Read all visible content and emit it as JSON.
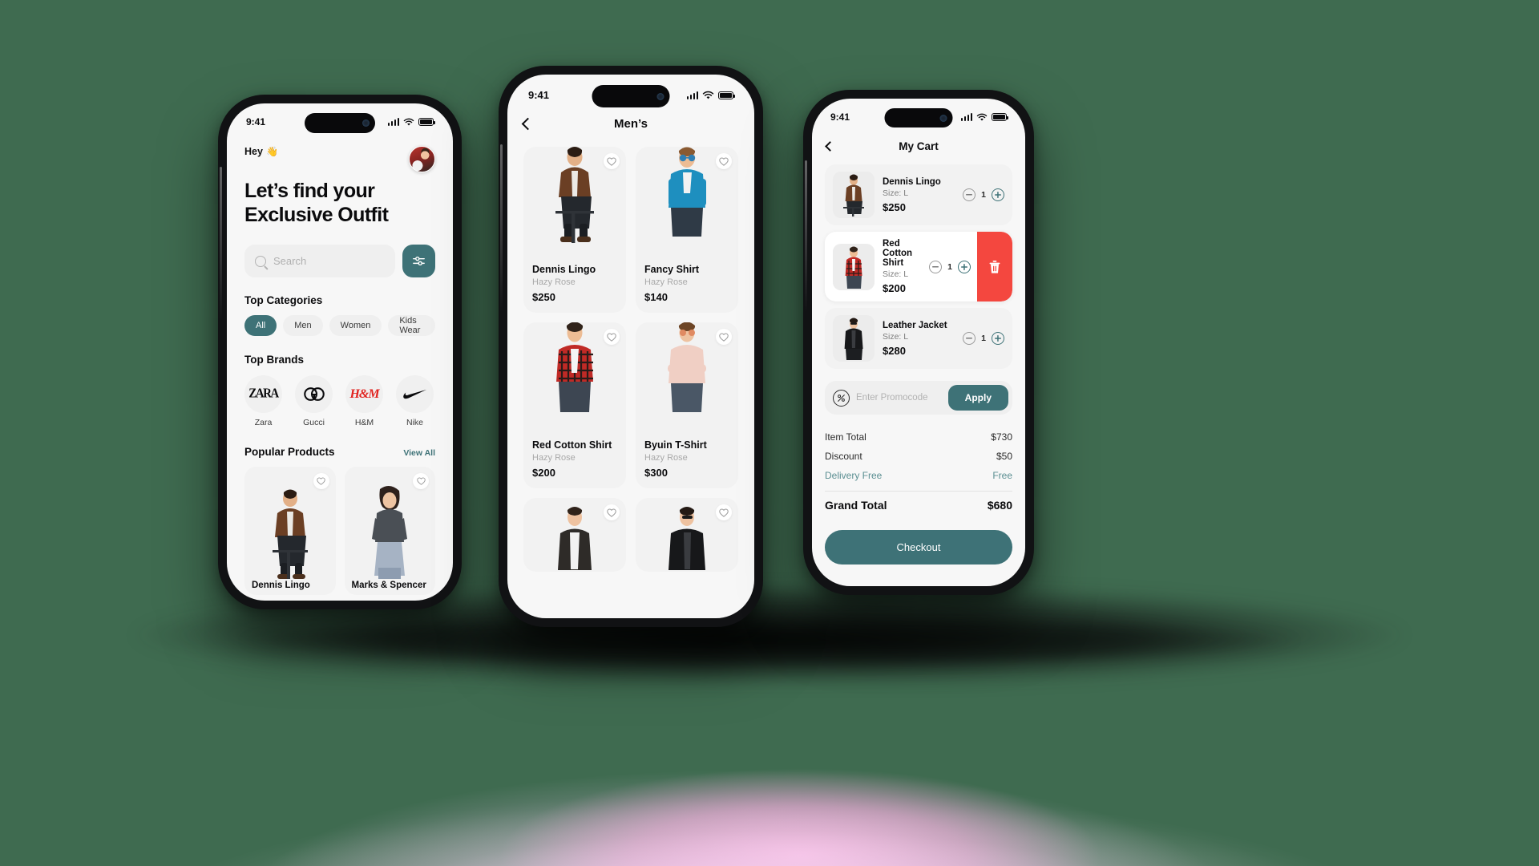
{
  "meta": {
    "accent": "#3e7277",
    "danger": "#f4473f",
    "screen_bg": "#f7f7f7"
  },
  "status": {
    "time": "9:41"
  },
  "home": {
    "greeting": "Hey",
    "wave_emoji": "👋",
    "title_line1": "Let’s find your",
    "title_line2": "Exclusive Outfit",
    "search": {
      "placeholder": "Search"
    },
    "filter_icon": "sliders-icon",
    "categories_title": "Top Categories",
    "categories": [
      {
        "label": "All",
        "active": true
      },
      {
        "label": "Men",
        "active": false
      },
      {
        "label": "Women",
        "active": false
      },
      {
        "label": "Kids Wear",
        "active": false
      }
    ],
    "brands_title": "Top Brands",
    "brands": [
      {
        "name": "Zara",
        "logo_text": "ZARA"
      },
      {
        "name": "Gucci",
        "logo_text": "GG"
      },
      {
        "name": "H&M",
        "logo_text": "H&M"
      },
      {
        "name": "Nike",
        "logo_text": "swoosh"
      }
    ],
    "popular_title": "Popular Products",
    "view_all": "View All",
    "popular": [
      {
        "name": "Dennis Lingo"
      },
      {
        "name": "Marks & Spencer"
      }
    ]
  },
  "mens": {
    "title": "Men’s",
    "back_icon": "chevron-left-icon",
    "products": [
      {
        "name": "Dennis Lingo",
        "brand": "Hazy Rose",
        "price": "$250"
      },
      {
        "name": "Fancy Shirt",
        "brand": "Hazy Rose",
        "price": "$140"
      },
      {
        "name": "Red Cotton Shirt",
        "brand": "Hazy Rose",
        "price": "$200"
      },
      {
        "name": "Byuin T-Shirt",
        "brand": "Hazy Rose",
        "price": "$300"
      }
    ]
  },
  "cart": {
    "title": "My Cart",
    "back_icon": "chevron-left-icon",
    "items": [
      {
        "name": "Dennis Lingo",
        "size": "Size: L",
        "price": "$250",
        "qty": "1"
      },
      {
        "name": "Red Cotton Shirt",
        "size": "Size: L",
        "price": "$200",
        "qty": "1"
      },
      {
        "name": "Leather Jacket",
        "size": "Size: L",
        "price": "$280",
        "qty": "1"
      }
    ],
    "promo": {
      "placeholder": "Enter Promocode",
      "apply_label": "Apply",
      "icon": "percent-icon"
    },
    "summary": [
      {
        "label": "Item Total",
        "value": "$730",
        "highlight": false
      },
      {
        "label": "Discount",
        "value": "$50",
        "highlight": false
      },
      {
        "label": "Delivery Free",
        "value": "Free",
        "highlight": true
      }
    ],
    "grand_total": {
      "label": "Grand Total",
      "value": "$680"
    },
    "checkout_label": "Checkout",
    "delete_icon": "trash-icon"
  }
}
